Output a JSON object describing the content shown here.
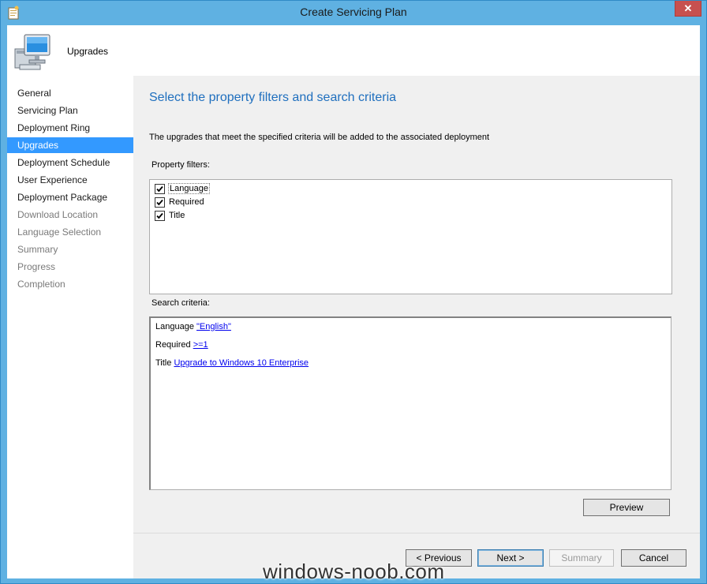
{
  "window": {
    "title": "Create Servicing Plan",
    "close_glyph": "✕"
  },
  "header": {
    "title": "Upgrades",
    "icon": "computer-icon"
  },
  "sidebar": {
    "items": [
      {
        "label": "General",
        "state": "normal"
      },
      {
        "label": "Servicing Plan",
        "state": "normal"
      },
      {
        "label": "Deployment Ring",
        "state": "normal"
      },
      {
        "label": "Upgrades",
        "state": "selected"
      },
      {
        "label": "Deployment Schedule",
        "state": "normal"
      },
      {
        "label": "User Experience",
        "state": "normal"
      },
      {
        "label": "Deployment Package",
        "state": "normal"
      },
      {
        "label": "Download Location",
        "state": "disabled"
      },
      {
        "label": "Language Selection",
        "state": "disabled"
      },
      {
        "label": "Summary",
        "state": "disabled"
      },
      {
        "label": "Progress",
        "state": "disabled"
      },
      {
        "label": "Completion",
        "state": "disabled"
      }
    ]
  },
  "main": {
    "section_title": "Select the property filters and search criteria",
    "description": "The upgrades that meet the specified criteria will be added to the associated deployment",
    "filters_label": "Property filters:",
    "filters": [
      {
        "label": "Language",
        "checked": true
      },
      {
        "label": "Required",
        "checked": true
      },
      {
        "label": "Title",
        "checked": true
      }
    ],
    "criteria_label": "Search criteria:",
    "criteria": [
      {
        "name": "Language",
        "value": "\"English\""
      },
      {
        "name": "Required",
        "value": ">=1"
      },
      {
        "name": "Title",
        "value": "Upgrade to Windows 10 Enterprise"
      }
    ],
    "preview_label": "Preview"
  },
  "footer": {
    "previous_label": "< Previous",
    "next_label": "Next >",
    "summary_label": "Summary",
    "cancel_label": "Cancel"
  },
  "watermark": "windows-noob.com",
  "colors": {
    "titlebar": "#5fb1e2",
    "selected": "#3399ff",
    "heading": "#1f6fbe",
    "link": "#0000ee"
  }
}
